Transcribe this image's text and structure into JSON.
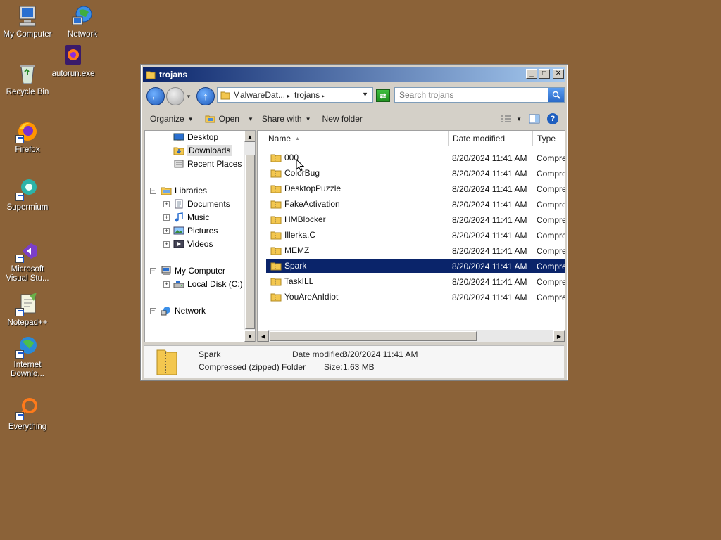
{
  "desktop": {
    "icons": [
      {
        "label": "My Computer",
        "icon": "computer-icon"
      },
      {
        "label": "Network",
        "icon": "network-icon"
      },
      {
        "label": "autorun.exe",
        "icon": "firefox-icon"
      },
      {
        "label": "Recycle Bin",
        "icon": "recycle-bin-icon"
      },
      {
        "label": "Firefox",
        "icon": "firefox-icon"
      },
      {
        "label": "Supermium",
        "icon": "supermium-icon"
      },
      {
        "label": "Microsoft Visual Stu...",
        "icon": "visual-studio-icon"
      },
      {
        "label": "Notepad++",
        "icon": "notepadpp-icon"
      },
      {
        "label": "Internet Downlo...",
        "icon": "idm-icon"
      },
      {
        "label": "Everything",
        "icon": "everything-icon"
      }
    ]
  },
  "window": {
    "title": "trojans",
    "address": {
      "crumbs": [
        "MalwareDat...",
        "trojans"
      ]
    },
    "search": {
      "placeholder": "Search trojans"
    },
    "toolbar": {
      "organize": "Organize",
      "open": "Open",
      "share_with": "Share with",
      "new_folder": "New folder"
    },
    "nav": {
      "desktop": "Desktop",
      "downloads": "Downloads",
      "recent_places": "Recent Places",
      "libraries": "Libraries",
      "documents": "Documents",
      "music": "Music",
      "pictures": "Pictures",
      "videos": "Videos",
      "my_computer": "My Computer",
      "local_disk": "Local Disk (C:)",
      "network": "Network"
    },
    "columns": {
      "name": "Name",
      "date_modified": "Date modified",
      "type": "Type"
    },
    "files": [
      {
        "name": "000",
        "date": "8/20/2024 11:41 AM",
        "type": "Compres"
      },
      {
        "name": "ColorBug",
        "date": "8/20/2024 11:41 AM",
        "type": "Compres"
      },
      {
        "name": "DesktopPuzzle",
        "date": "8/20/2024 11:41 AM",
        "type": "Compres"
      },
      {
        "name": "FakeActivation",
        "date": "8/20/2024 11:41 AM",
        "type": "Compres"
      },
      {
        "name": "HMBlocker",
        "date": "8/20/2024 11:41 AM",
        "type": "Compres"
      },
      {
        "name": "Illerka.C",
        "date": "8/20/2024 11:41 AM",
        "type": "Compres"
      },
      {
        "name": "MEMZ",
        "date": "8/20/2024 11:41 AM",
        "type": "Compres"
      },
      {
        "name": "Spark",
        "date": "8/20/2024 11:41 AM",
        "type": "Compres",
        "selected": true
      },
      {
        "name": "TaskILL",
        "date": "8/20/2024 11:41 AM",
        "type": "Compres"
      },
      {
        "name": "YouAreAnIdiot",
        "date": "8/20/2024 11:41 AM",
        "type": "Compres"
      }
    ],
    "details": {
      "name": "Spark",
      "type": "Compressed (zipped) Folder",
      "date_label": "Date modified:",
      "date_value": "8/20/2024 11:41 AM",
      "size_label": "Size:",
      "size_value": "1.63 MB"
    }
  }
}
